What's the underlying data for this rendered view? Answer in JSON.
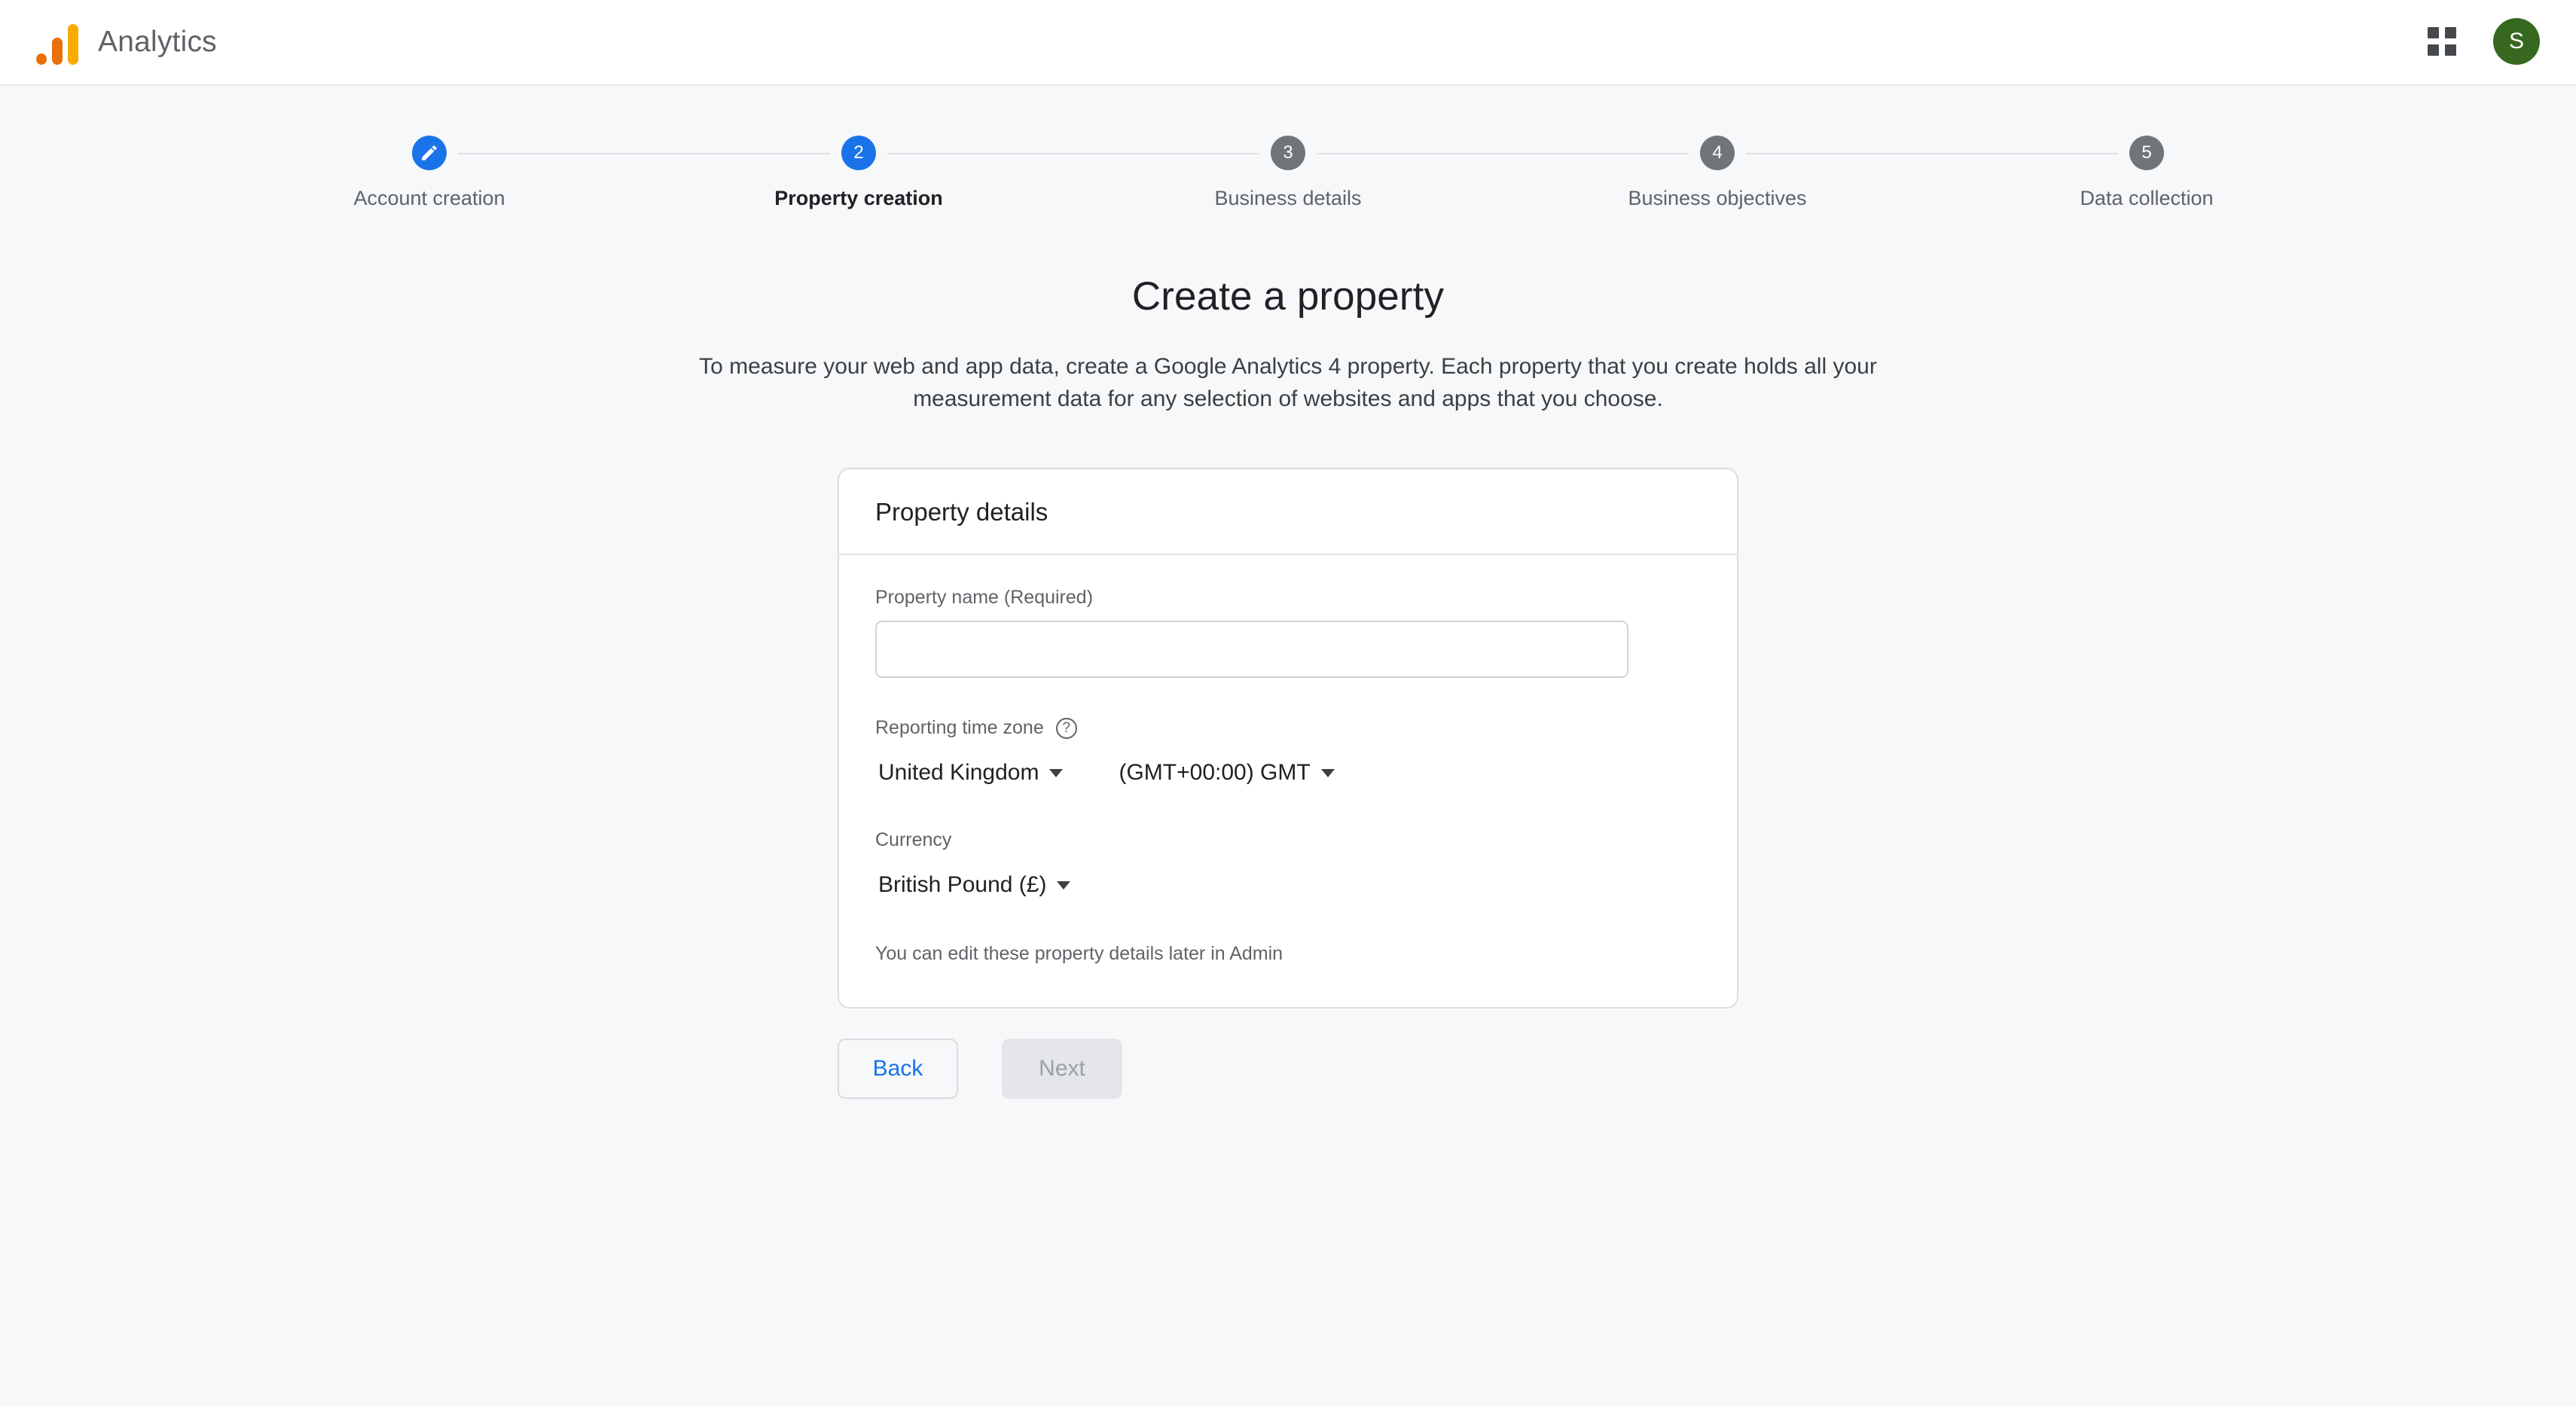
{
  "header": {
    "logo_icon": "google-analytics-logo",
    "product_title": "Analytics",
    "apps_icon": "apps-grid-icon",
    "avatar_initial": "S",
    "avatar_color": "#37681f"
  },
  "stepper": {
    "active_color": "#1a73e8",
    "inactive_color": "#70757a",
    "steps": [
      {
        "marker": "pencil-icon",
        "number": "",
        "label": "Account creation",
        "state": "done"
      },
      {
        "marker": "number",
        "number": "2",
        "label": "Property creation",
        "state": "active"
      },
      {
        "marker": "number",
        "number": "3",
        "label": "Business details",
        "state": "upcoming"
      },
      {
        "marker": "number",
        "number": "4",
        "label": "Business objectives",
        "state": "upcoming"
      },
      {
        "marker": "number",
        "number": "5",
        "label": "Data collection",
        "state": "upcoming"
      }
    ]
  },
  "page": {
    "title": "Create a property",
    "description": "To measure your web and app data, create a Google Analytics 4 property. Each property that you create holds all your measurement data for any selection of websites and apps that you choose."
  },
  "card": {
    "title": "Property details",
    "property_name": {
      "label": "Property name (Required)",
      "value": "",
      "placeholder": ""
    },
    "time_zone": {
      "label": "Reporting time zone",
      "help_icon": "help-circle-icon",
      "country_value": "United Kingdom",
      "zone_value": "(GMT+00:00) GMT"
    },
    "currency": {
      "label": "Currency",
      "value": "British Pound (£)"
    },
    "helper_text": "You can edit these property details later in Admin"
  },
  "actions": {
    "back_label": "Back",
    "next_label": "Next",
    "back_color": "#1a73e8",
    "next_disabled": true
  }
}
